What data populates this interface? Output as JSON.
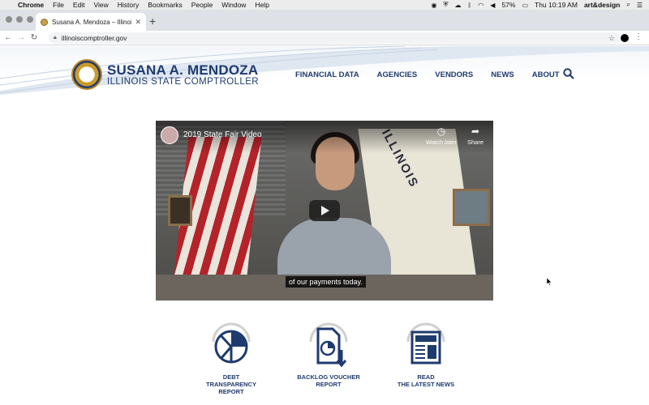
{
  "menubar": {
    "app": "Chrome",
    "items": [
      "File",
      "Edit",
      "View",
      "History",
      "Bookmarks",
      "People",
      "Window",
      "Help"
    ],
    "battery": "57%",
    "clock": "Thu 10:19 AM",
    "user": "art&design"
  },
  "browser": {
    "tab_title": "Susana A. Mendoza – Illinois St",
    "url": "illinoiscomptroller.gov"
  },
  "site": {
    "brand_name": "SUSANA A. MENDOZA",
    "brand_subtitle": "ILLINOIS STATE COMPTROLLER",
    "nav": [
      "FINANCIAL DATA",
      "AGENCIES",
      "VENDORS",
      "NEWS",
      "ABOUT"
    ]
  },
  "video": {
    "title": "2019 State Fair Video",
    "watch_later": "Watch later",
    "share": "Share",
    "caption": "of our payments today.",
    "flag_text": "ILLINOIS"
  },
  "quick_links": [
    {
      "line1": "DEBT TRANSPARENCY",
      "line2": "REPORT",
      "icon": "pie-chart-icon"
    },
    {
      "line1": "BACKLOG VOUCHER",
      "line2": "REPORT",
      "icon": "document-download-icon"
    },
    {
      "line1": "READ",
      "line2": "THE LATEST NEWS",
      "icon": "newspaper-icon"
    }
  ],
  "colors": {
    "brand": "#1f3b6e",
    "gold": "#c99b2d"
  }
}
